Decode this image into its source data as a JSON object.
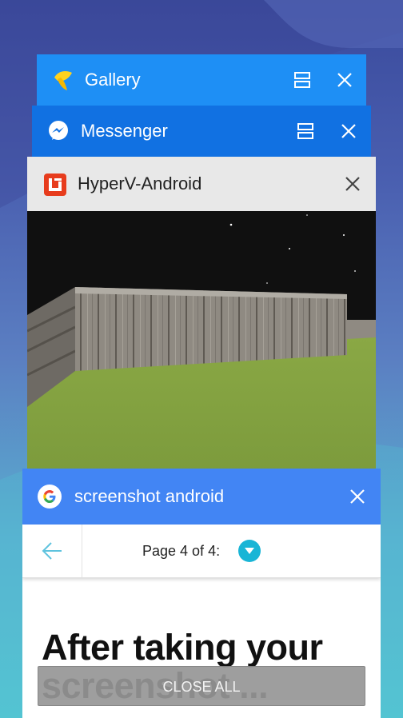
{
  "recents": {
    "gallery": {
      "title": "Gallery",
      "color": "#1e8ff5"
    },
    "messenger": {
      "title": "Messenger",
      "color": "#1171e2"
    },
    "hyperv": {
      "title": "HyperV-Android",
      "color": "#e8e8e8"
    },
    "google": {
      "title": "screenshot android",
      "color": "#4285f4",
      "page_label": "Page 4 of 4:",
      "headline": "After taking your screenshot ..."
    }
  },
  "close_all_label": "CLOSE ALL",
  "icons": {
    "gallery": "gallery-leaf-icon",
    "messenger": "messenger-bolt-icon",
    "hyperv": "monogame-icon",
    "google": "google-g-icon",
    "split": "split-screen-icon",
    "close": "close-x-icon",
    "back": "back-arrow-icon",
    "dropdown": "chevron-down-icon"
  }
}
